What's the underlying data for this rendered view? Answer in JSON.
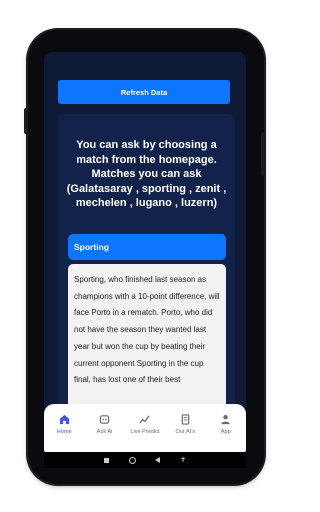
{
  "colors": {
    "accent": "#0d75ff",
    "screen_bg": "#0f1a36",
    "card_bg": "#13224a",
    "tab_active": "#4d55d6"
  },
  "toolbar": {
    "refresh_label": "Refresh Data"
  },
  "card": {
    "headline": "You can ask by choosing a match from the homepage. Matches you can ask (Galatasaray , sporting , zenit , mechelen , lugano , luzern)",
    "selected_team": "Sporting",
    "answer": "Sporting, who finished last season as champions with a 10-point difference, will face Porto in a rematch. Porto, who did not have the season they wanted last year but won the cup by beating their current opponent Sporting in the cup final, has lost one of their best"
  },
  "tabs": [
    {
      "label": "Home",
      "icon": "home-icon",
      "active": true
    },
    {
      "label": "Ask Ai",
      "icon": "ask-ai-icon",
      "active": false
    },
    {
      "label": "Live Predict",
      "icon": "live-predict-icon",
      "active": false
    },
    {
      "label": "Our AI's",
      "icon": "book-icon",
      "active": false
    },
    {
      "label": "App",
      "icon": "user-icon",
      "active": false
    }
  ],
  "system_nav": {
    "recents_icon": "square-icon",
    "home_icon": "circle-icon",
    "back_icon": "triangle-back-icon",
    "accessibility_icon": "accessibility-icon"
  }
}
